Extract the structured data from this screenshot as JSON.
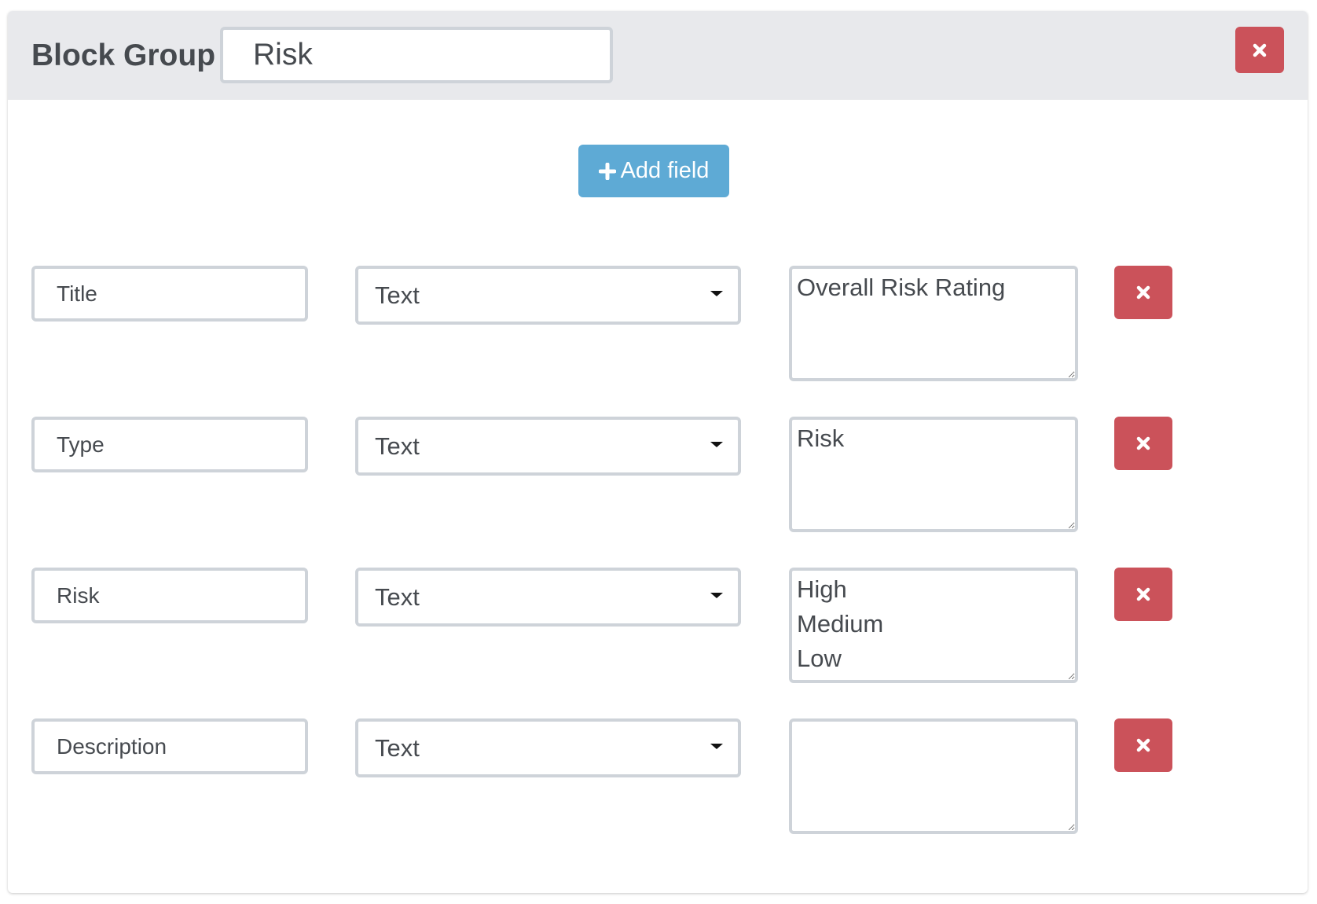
{
  "header": {
    "title": "Block Group",
    "group_name_value": "Risk",
    "delete_icon": "close-icon"
  },
  "toolbar": {
    "add_field_label": "Add field",
    "add_field_icon": "plus-icon"
  },
  "fields": [
    {
      "name": "Title",
      "type": "Text",
      "value": "Overall Risk Rating"
    },
    {
      "name": "Type",
      "type": "Text",
      "value": "Risk"
    },
    {
      "name": "Risk",
      "type": "Text",
      "value": "High\nMedium\nLow"
    },
    {
      "name": "Description",
      "type": "Text",
      "value": ""
    }
  ],
  "colors": {
    "header_bg": "#e8e9ec",
    "danger": "#cb525a",
    "primary": "#5eaad5",
    "border": "#ced3d9",
    "text": "#464a4f"
  }
}
